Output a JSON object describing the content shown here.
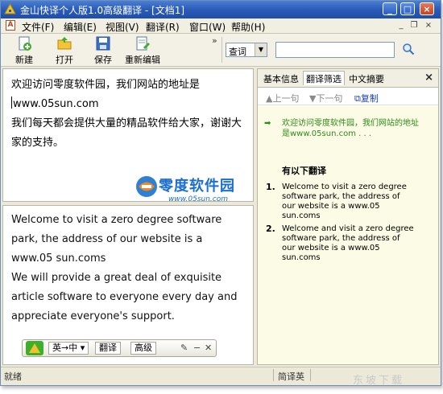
{
  "window": {
    "title": "金山快译个人版1.0高级翻译 - [文档1]"
  },
  "menu": [
    {
      "label": "文件(F)"
    },
    {
      "label": "编辑(E)"
    },
    {
      "label": "视图(V)"
    },
    {
      "label": "翻译(R)"
    },
    {
      "label": "窗口(W)"
    },
    {
      "label": "帮助(H)"
    }
  ],
  "toolbar": {
    "new_label": "新建",
    "open_label": "打开",
    "save_label": "保存",
    "reedit_label": "重新编辑",
    "dict_select_value": "查词",
    "search_value": ""
  },
  "source": {
    "lines": [
      "欢迎访问零度软件园，我们网站的地址是",
      "www.05sun.com",
      "我们每天都会提供大量的精品软件给大家，谢谢大家的支持。"
    ]
  },
  "watermark": {
    "name": "零度软件园",
    "url": "www.05sun.com"
  },
  "target": {
    "lines": [
      "Welcome to visit a zero degree software",
      "park, the address of our website is a",
      "www.05 sun.coms",
      "We will provide a great deal of exquisite",
      "article software to everyone every day and",
      "appreciate everyone's support."
    ]
  },
  "minibar": {
    "direction": "英→中",
    "translate_label": "翻译",
    "advanced_label": "高级"
  },
  "right_panel": {
    "tabs": [
      {
        "label": "基本信息"
      },
      {
        "label": "翻译筛选"
      },
      {
        "label": "中文摘要"
      }
    ],
    "prev_label": "上一句",
    "next_label": "下一句",
    "copy_label": "复制",
    "source_line1": "欢迎访问零度软件园，我们网站的地址",
    "source_line2": "是www.05sun.com . . .",
    "heading": "有以下翻译",
    "results": [
      {
        "num": "1.",
        "lines": [
          "Welcome to visit a zero degree",
          "software park, the address of",
          "our website is a www.05",
          "sun.coms"
        ]
      },
      {
        "num": "2.",
        "lines": [
          "Welcome and visit a zero degree",
          "software park, the address of",
          "our website is a www.05",
          "sun.coms"
        ]
      }
    ]
  },
  "statusbar": {
    "status": "就绪",
    "lang": "简译英"
  },
  "page_watermark": "东坡下载"
}
